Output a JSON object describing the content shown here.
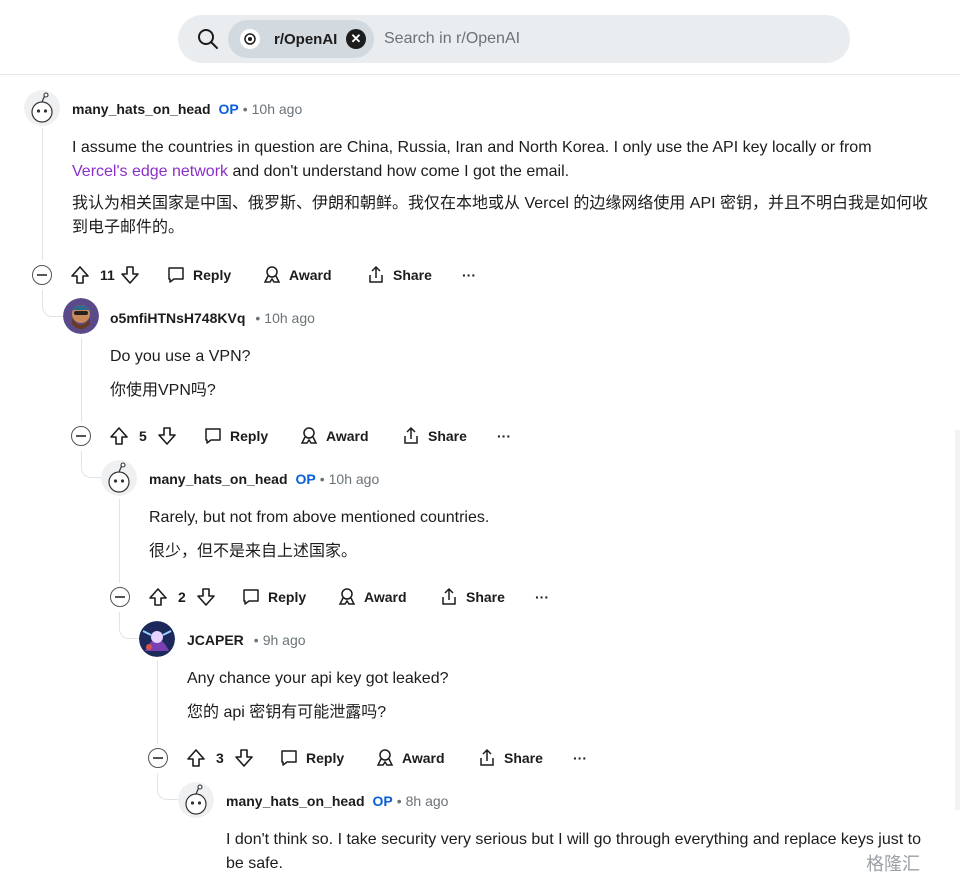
{
  "search": {
    "community": "r/OpenAI",
    "placeholder": "Search in r/OpenAI"
  },
  "comments": [
    {
      "user": "many_hats_on_head",
      "op": "OP",
      "time": "10h ago",
      "body_line1_a": "I assume the countries in question are China, Russia, Iran and North Korea. I only use the API key locally or from",
      "link": "Vercel's edge network",
      "body_line1_b": " and don't understand how come I got the email.",
      "translation": "我认为相关国家是中国、俄罗斯、伊朗和朝鲜。我仅在本地或从 Vercel 的边缘网络使用 API 密钥，并且不明白我是如何收到电子邮件的。",
      "votes": "11"
    },
    {
      "user": "o5mfiHTNsH748KVq",
      "time": "10h ago",
      "body": "Do you use a VPN?",
      "translation": "你使用VPN吗?",
      "votes": "5"
    },
    {
      "user": "many_hats_on_head",
      "op": "OP",
      "time": "10h ago",
      "body": "Rarely, but not from above mentioned countries.",
      "translation": "很少，但不是来自上述国家。",
      "votes": "2"
    },
    {
      "user": "JCAPER",
      "time": "9h ago",
      "body": "Any chance your api key got leaked?",
      "translation": "您的 api 密钥有可能泄露吗?",
      "votes": "3"
    },
    {
      "user": "many_hats_on_head",
      "op": "OP",
      "time": "8h ago",
      "body": "I don't think so. I take security very serious but I will go through everything and replace keys just to be safe."
    }
  ],
  "actions": {
    "reply": "Reply",
    "award": "Award",
    "share": "Share",
    "more": "···"
  },
  "watermark": "格隆汇",
  "colors": {
    "op": "#0a5fd8",
    "link": "#8b2fc9",
    "muted": "#6a7378"
  }
}
